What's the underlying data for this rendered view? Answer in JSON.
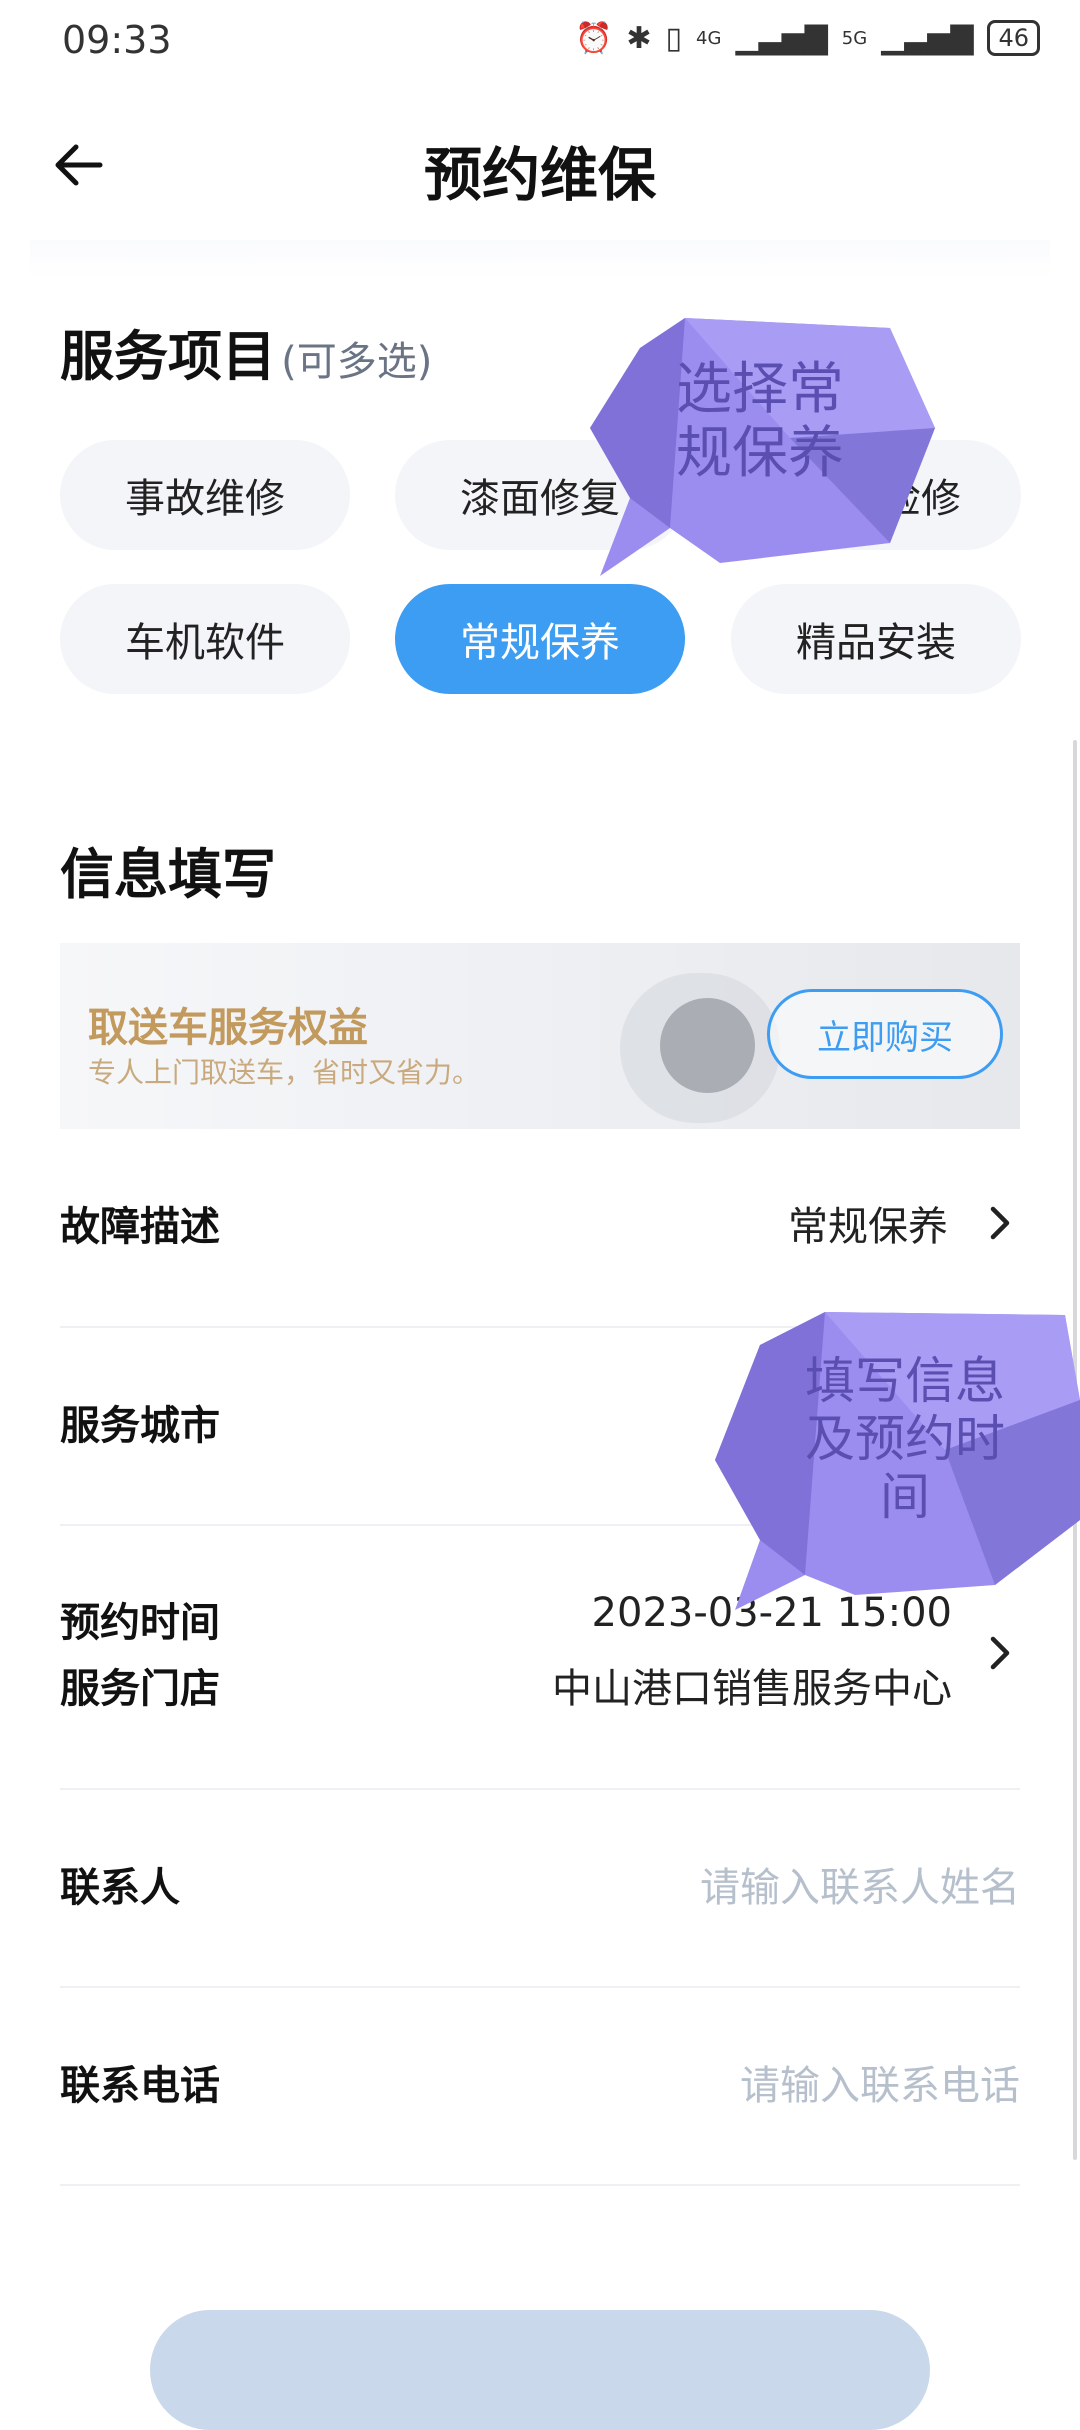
{
  "status_bar": {
    "time": "09:33",
    "signal_4g": "4G",
    "signal_5g": "5G",
    "battery": "46"
  },
  "header": {
    "title": "预约维保"
  },
  "services": {
    "title": "服务项目",
    "note": "(可多选)",
    "chips": [
      {
        "label": "事故维修",
        "selected": false
      },
      {
        "label": "漆面修复",
        "selected": false
      },
      {
        "label": "检修",
        "selected": false
      },
      {
        "label": "车机软件",
        "selected": false
      },
      {
        "label": "常规保养",
        "selected": true
      },
      {
        "label": "精品安装",
        "selected": false
      }
    ]
  },
  "info": {
    "title": "信息填写"
  },
  "promo": {
    "title": "取送车服务权益",
    "subtitle": "专人上门取送车，省时又省力。",
    "button": "立即购买"
  },
  "form": {
    "fault_label": "故障描述",
    "fault_value": "常规保养",
    "city_label": "服务城市",
    "time_label": "预约时间",
    "time_value": "2023-03-21 15:00",
    "store_label": "服务门店",
    "store_value": "中山港口销售服务中心",
    "contact_label": "联系人",
    "contact_placeholder": "请输入联系人姓名",
    "phone_label": "联系电话",
    "phone_placeholder": "请输入联系电话"
  },
  "annotations": {
    "bubble1": "选择常规保养",
    "bubble1_line1": "选择常",
    "bubble1_line2": "规保养",
    "bubble2_line1": "填写信息",
    "bubble2_line2": "及预约时",
    "bubble2_line3": "间"
  },
  "colors": {
    "accent": "#3d9df2",
    "promo_gold": "#c29a5e",
    "bubble": "#9b8df0"
  }
}
